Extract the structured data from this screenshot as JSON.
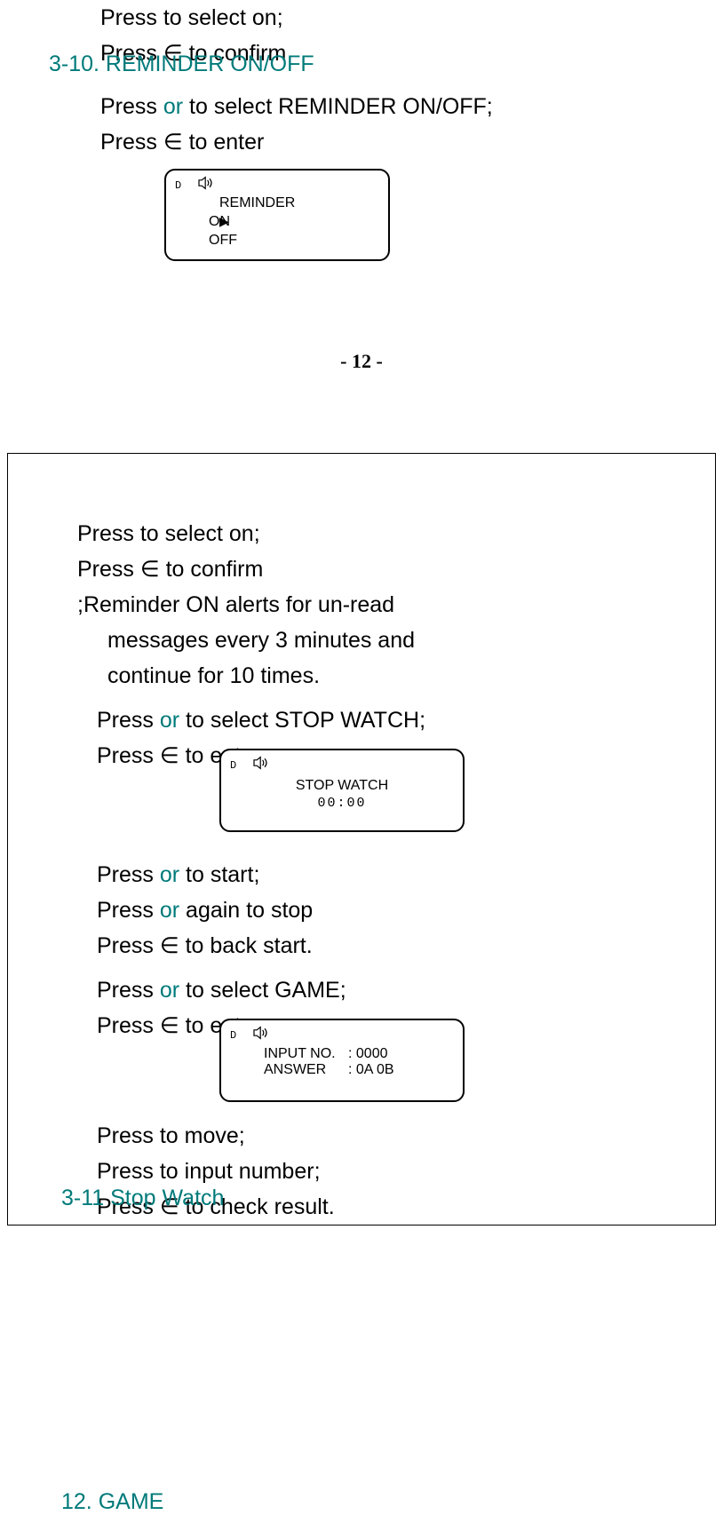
{
  "page1": {
    "line1": "Press   to select on;",
    "line2_a": "Press ∈ to confirm",
    "heading310": "3-10. REMINDER ON/OFF",
    "line3_a": "Press  ",
    "line3_or": "or",
    "line3_b": "  to select REMINDER ON/OFF;",
    "line4": "Press ∈ to enter",
    "screen1": {
      "title": "REMINDER",
      "opt1": "ON",
      "opt2": "OFF"
    },
    "pagenum": "- 12 -"
  },
  "page2": {
    "line1": "Press   to select on;",
    "line2": "Press ∈ to confirm",
    "line3": ";Reminder ON alerts for un-read",
    "line4": "messages every 3 minutes and",
    "line5": "continue for 10 times.",
    "heading311": "3-11 Stop Watch",
    "line6_a": "Press  ",
    "line6_or": "or",
    "line6_b": "  to select STOP WATCH;",
    "line7": "Press ∈ to enter",
    "screen2": {
      "title": "STOP WATCH",
      "time": "00:00"
    },
    "line8_a": "Press  ",
    "line8_or": "or",
    "line8_b": "  to start;",
    "line9_a": "Press  ",
    "line9_or": "or",
    "line9_b": "  again to stop",
    "line10": "Press ∈ to back start.",
    "heading12": "12. GAME",
    "line11_a": "Press  ",
    "line11_or": "or",
    "line11_b": "  to select GAME;",
    "line12": "Press ∈ to enter",
    "screen3": {
      "row1_label": "INPUT NO.",
      "row1_val": ": 0000",
      "row2_label": "ANSWER",
      "row2_val": ": 0A 0B"
    },
    "line13": "Press  to move;",
    "line14": "Press  to input number;",
    "line15": "Press ∈ to check result."
  }
}
